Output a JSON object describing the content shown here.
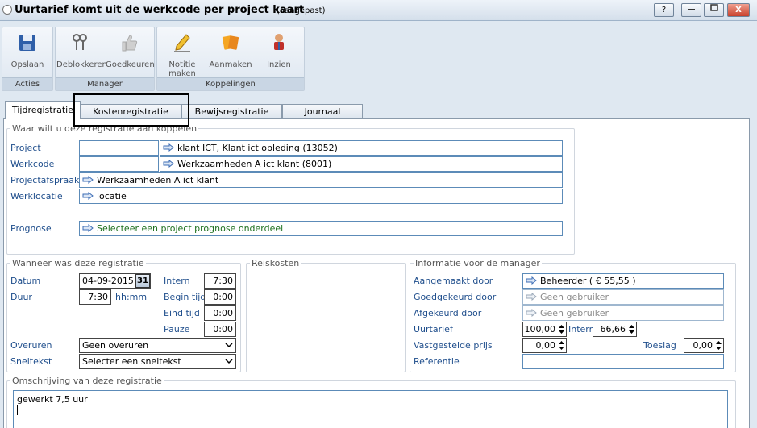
{
  "window": {
    "title": "Uurtarief komt uit de werkcode per project kaart",
    "title_suffix": "(aangepast)",
    "help": "?",
    "minimize": "",
    "maximize": "",
    "close": "X"
  },
  "ribbon": {
    "groups": [
      {
        "label": "Acties"
      },
      {
        "label": "Manager"
      },
      {
        "label": "Koppelingen"
      }
    ],
    "buttons": {
      "opslaan": "Opslaan",
      "deblokkeren": "Deblokkeren",
      "goedkeuren": "Goedkeuren",
      "notitie": "Notitie maken",
      "aanmaken": "Aanmaken",
      "inzien": "Inzien"
    }
  },
  "tabs": [
    "Tijdregistratie",
    "Kostenregistratie",
    "Bewijsregistratie",
    "Journaal"
  ],
  "koppelen": {
    "legend": "Waar wilt u deze registratie aan koppelen",
    "project_label": "Project",
    "project_value": "klant ICT, Klant ict opleding (13052)",
    "werkcode_label": "Werkcode",
    "werkcode_value": "Werkzaamheden A ict klant (8001)",
    "afspraak_label": "Projectafspraak",
    "afspraak_value": "Werkzaamheden A ict klant",
    "locatie_label": "Werklocatie",
    "locatie_value": "locatie",
    "prognose_label": "Prognose",
    "prognose_value": "Selecteer een project prognose onderdeel"
  },
  "wanneer": {
    "legend": "Wanneer was deze registratie",
    "datum_label": "Datum",
    "datum_value": "04-09-2015",
    "cal": "31",
    "duur_label": "Duur",
    "duur_value": "7:30",
    "duur_unit": "hh:mm",
    "intern_label": "Intern",
    "intern_value": "7:30",
    "begin_label": "Begin tijd",
    "begin_value": "0:00",
    "eind_label": "Eind tijd",
    "eind_value": "0:00",
    "pauze_label": "Pauze",
    "pauze_value": "0:00",
    "overuren_label": "Overuren",
    "overuren_value": "Geen overuren",
    "sneltekst_label": "Sneltekst",
    "sneltekst_value": "Selecter een sneltekst"
  },
  "reiskosten": {
    "legend": "Reiskosten"
  },
  "manager": {
    "legend": "Informatie voor de manager",
    "aangemaakt_label": "Aangemaakt door",
    "aangemaakt_value": "Beheerder ( € 55,55 )",
    "goedgekeurd_label": "Goedgekeurd door",
    "goedgekeurd_value": "Geen gebruiker",
    "afgekeurd_label": "Afgekeurd door",
    "afgekeurd_value": "Geen gebruiker",
    "uurtarief_label": "Uurtarief",
    "uurtarief_value": "100,00",
    "intern_label": "Intern",
    "intern_value": "66,66",
    "vastgesteld_label": "Vastgestelde prijs",
    "vastgesteld_value": "0,00",
    "toeslag_label": "Toeslag",
    "toeslag_value": "0,00",
    "referentie_label": "Referentie",
    "referentie_value": ""
  },
  "omschrijving": {
    "legend": "Omschrijving van deze registratie",
    "text": "gewerkt 7,5 uur"
  },
  "colors": {
    "label_blue": "#1f4e8c",
    "arrow_blue": "#3d6db5",
    "field_border": "#5c8bb8",
    "green_text": "#1c6f1c"
  }
}
